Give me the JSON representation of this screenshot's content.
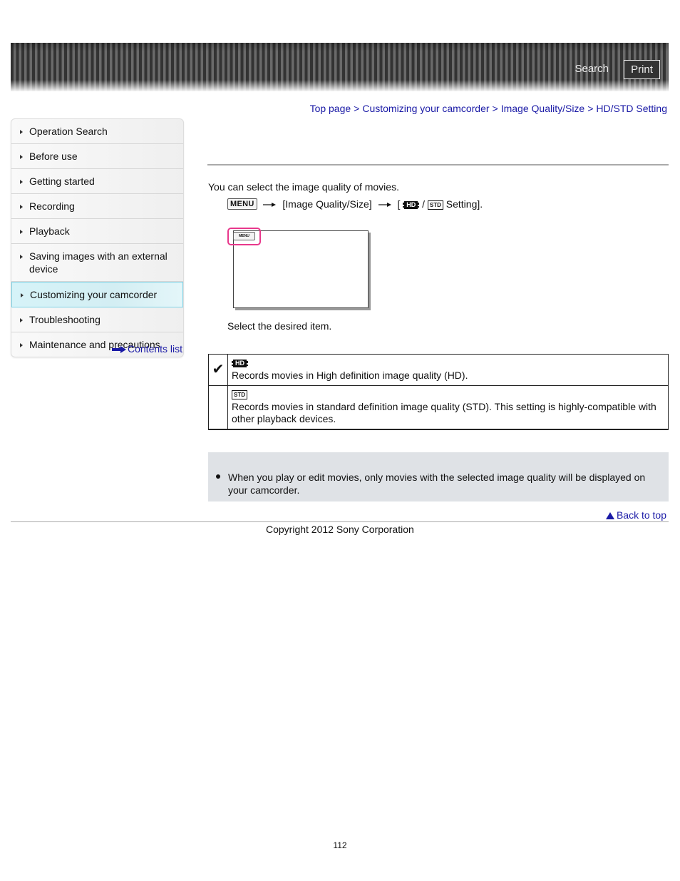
{
  "header": {
    "search_label": "Search",
    "print_label": "Print"
  },
  "breadcrumb": {
    "items": [
      "Top page",
      "Customizing your camcorder",
      "Image Quality/Size",
      "HD/STD Setting"
    ],
    "separator": ">"
  },
  "sidebar": {
    "items": [
      {
        "label": "Operation Search",
        "active": false
      },
      {
        "label": "Before use",
        "active": false
      },
      {
        "label": "Getting started",
        "active": false
      },
      {
        "label": "Recording",
        "active": false
      },
      {
        "label": "Playback",
        "active": false
      },
      {
        "label": "Saving images with an external device",
        "active": false
      },
      {
        "label": "Customizing your camcorder",
        "active": true
      },
      {
        "label": "Troubleshooting",
        "active": false
      },
      {
        "label": "Maintenance and precautions",
        "active": false
      }
    ],
    "contents_link": "Contents list"
  },
  "main": {
    "intro": "You can select the image quality of movies.",
    "path": {
      "menu_key": "MENU",
      "step1": "[Image Quality/Size]",
      "step2_open": "[",
      "hd_icon": "HD",
      "slash": "/",
      "std_icon": "STD",
      "step2_close": "Setting]."
    },
    "screen_menu_label": "MENU",
    "select_text": "Select the desired item.",
    "options": [
      {
        "icon": "HD",
        "selected": true,
        "description": "Records movies in High definition image quality (HD)."
      },
      {
        "icon": "STD",
        "selected": false,
        "description": "Records movies in standard definition image quality (STD). This setting is highly-compatible with other playback devices."
      }
    ],
    "check_glyph": "✔",
    "note": "When you play or edit movies, only movies with the selected image quality will be displayed on your camcorder."
  },
  "footer": {
    "back_to_top": "Back to top",
    "copyright": "Copyright 2012 Sony Corporation",
    "page_number": "112"
  },
  "colors": {
    "link": "#1a1aa6",
    "active_item_bg": "#d6f3f8",
    "active_item_border": "#7fd3e6",
    "highlight_pink": "#e8388c",
    "note_bg": "#dfe2e6"
  }
}
